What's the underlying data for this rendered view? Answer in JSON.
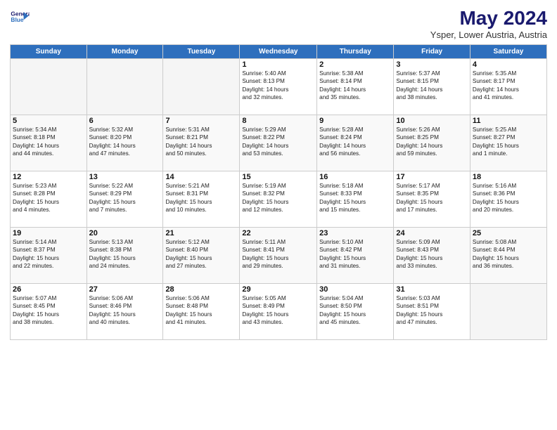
{
  "header": {
    "logo_line1": "General",
    "logo_line2": "Blue",
    "month": "May 2024",
    "location": "Ysper, Lower Austria, Austria"
  },
  "weekdays": [
    "Sunday",
    "Monday",
    "Tuesday",
    "Wednesday",
    "Thursday",
    "Friday",
    "Saturday"
  ],
  "weeks": [
    [
      {
        "day": "",
        "info": ""
      },
      {
        "day": "",
        "info": ""
      },
      {
        "day": "",
        "info": ""
      },
      {
        "day": "1",
        "info": "Sunrise: 5:40 AM\nSunset: 8:13 PM\nDaylight: 14 hours\nand 32 minutes."
      },
      {
        "day": "2",
        "info": "Sunrise: 5:38 AM\nSunset: 8:14 PM\nDaylight: 14 hours\nand 35 minutes."
      },
      {
        "day": "3",
        "info": "Sunrise: 5:37 AM\nSunset: 8:15 PM\nDaylight: 14 hours\nand 38 minutes."
      },
      {
        "day": "4",
        "info": "Sunrise: 5:35 AM\nSunset: 8:17 PM\nDaylight: 14 hours\nand 41 minutes."
      }
    ],
    [
      {
        "day": "5",
        "info": "Sunrise: 5:34 AM\nSunset: 8:18 PM\nDaylight: 14 hours\nand 44 minutes."
      },
      {
        "day": "6",
        "info": "Sunrise: 5:32 AM\nSunset: 8:20 PM\nDaylight: 14 hours\nand 47 minutes."
      },
      {
        "day": "7",
        "info": "Sunrise: 5:31 AM\nSunset: 8:21 PM\nDaylight: 14 hours\nand 50 minutes."
      },
      {
        "day": "8",
        "info": "Sunrise: 5:29 AM\nSunset: 8:22 PM\nDaylight: 14 hours\nand 53 minutes."
      },
      {
        "day": "9",
        "info": "Sunrise: 5:28 AM\nSunset: 8:24 PM\nDaylight: 14 hours\nand 56 minutes."
      },
      {
        "day": "10",
        "info": "Sunrise: 5:26 AM\nSunset: 8:25 PM\nDaylight: 14 hours\nand 59 minutes."
      },
      {
        "day": "11",
        "info": "Sunrise: 5:25 AM\nSunset: 8:27 PM\nDaylight: 15 hours\nand 1 minute."
      }
    ],
    [
      {
        "day": "12",
        "info": "Sunrise: 5:23 AM\nSunset: 8:28 PM\nDaylight: 15 hours\nand 4 minutes."
      },
      {
        "day": "13",
        "info": "Sunrise: 5:22 AM\nSunset: 8:29 PM\nDaylight: 15 hours\nand 7 minutes."
      },
      {
        "day": "14",
        "info": "Sunrise: 5:21 AM\nSunset: 8:31 PM\nDaylight: 15 hours\nand 10 minutes."
      },
      {
        "day": "15",
        "info": "Sunrise: 5:19 AM\nSunset: 8:32 PM\nDaylight: 15 hours\nand 12 minutes."
      },
      {
        "day": "16",
        "info": "Sunrise: 5:18 AM\nSunset: 8:33 PM\nDaylight: 15 hours\nand 15 minutes."
      },
      {
        "day": "17",
        "info": "Sunrise: 5:17 AM\nSunset: 8:35 PM\nDaylight: 15 hours\nand 17 minutes."
      },
      {
        "day": "18",
        "info": "Sunrise: 5:16 AM\nSunset: 8:36 PM\nDaylight: 15 hours\nand 20 minutes."
      }
    ],
    [
      {
        "day": "19",
        "info": "Sunrise: 5:14 AM\nSunset: 8:37 PM\nDaylight: 15 hours\nand 22 minutes."
      },
      {
        "day": "20",
        "info": "Sunrise: 5:13 AM\nSunset: 8:38 PM\nDaylight: 15 hours\nand 24 minutes."
      },
      {
        "day": "21",
        "info": "Sunrise: 5:12 AM\nSunset: 8:40 PM\nDaylight: 15 hours\nand 27 minutes."
      },
      {
        "day": "22",
        "info": "Sunrise: 5:11 AM\nSunset: 8:41 PM\nDaylight: 15 hours\nand 29 minutes."
      },
      {
        "day": "23",
        "info": "Sunrise: 5:10 AM\nSunset: 8:42 PM\nDaylight: 15 hours\nand 31 minutes."
      },
      {
        "day": "24",
        "info": "Sunrise: 5:09 AM\nSunset: 8:43 PM\nDaylight: 15 hours\nand 33 minutes."
      },
      {
        "day": "25",
        "info": "Sunrise: 5:08 AM\nSunset: 8:44 PM\nDaylight: 15 hours\nand 36 minutes."
      }
    ],
    [
      {
        "day": "26",
        "info": "Sunrise: 5:07 AM\nSunset: 8:45 PM\nDaylight: 15 hours\nand 38 minutes."
      },
      {
        "day": "27",
        "info": "Sunrise: 5:06 AM\nSunset: 8:46 PM\nDaylight: 15 hours\nand 40 minutes."
      },
      {
        "day": "28",
        "info": "Sunrise: 5:06 AM\nSunset: 8:48 PM\nDaylight: 15 hours\nand 41 minutes."
      },
      {
        "day": "29",
        "info": "Sunrise: 5:05 AM\nSunset: 8:49 PM\nDaylight: 15 hours\nand 43 minutes."
      },
      {
        "day": "30",
        "info": "Sunrise: 5:04 AM\nSunset: 8:50 PM\nDaylight: 15 hours\nand 45 minutes."
      },
      {
        "day": "31",
        "info": "Sunrise: 5:03 AM\nSunset: 8:51 PM\nDaylight: 15 hours\nand 47 minutes."
      },
      {
        "day": "",
        "info": ""
      }
    ]
  ]
}
